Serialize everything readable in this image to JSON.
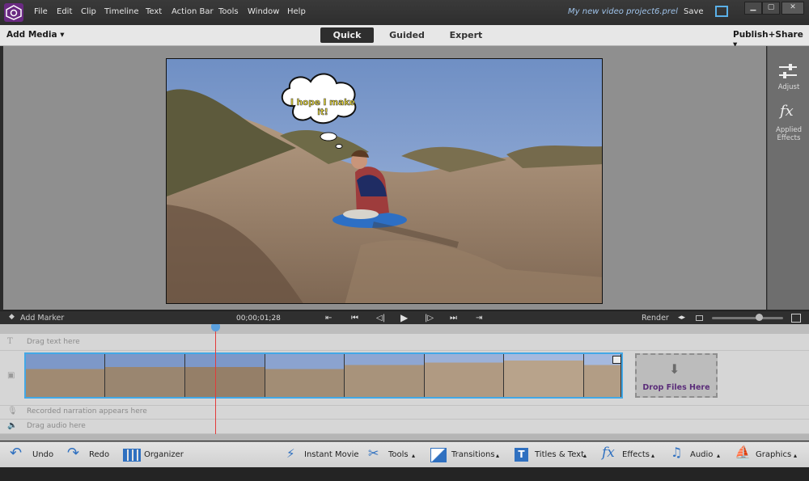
{
  "menubar": {
    "items": [
      "File",
      "Edit",
      "Clip",
      "Timeline",
      "Text",
      "Action Bar",
      "Tools",
      "Window",
      "Help"
    ],
    "project_name": "My new video project6.prel",
    "save_label": "Save"
  },
  "modebar": {
    "add_media_label": "Add Media",
    "tabs": [
      "Quick",
      "Guided",
      "Expert"
    ],
    "active_tab": "Quick",
    "publish_label": "Publish+Share"
  },
  "monitor": {
    "speech_bubble_text": "I hope I make it!"
  },
  "right_panel": {
    "adjust_label": "Adjust",
    "applied_effects_label": "Applied Effects"
  },
  "transport": {
    "add_marker_label": "Add Marker",
    "timecode": "00;00;01;28",
    "render_label": "Render"
  },
  "timeline": {
    "text_track_hint": "Drag text here",
    "narration_hint": "Recorded narration appears here",
    "audio_hint": "Drag audio here",
    "drop_files_label": "Drop Files Here"
  },
  "actionbar": {
    "undo_label": "Undo",
    "redo_label": "Redo",
    "organizer_label": "Organizer",
    "instant_movie_label": "Instant Movie",
    "tools_label": "Tools",
    "transitions_label": "Transitions",
    "titles_label": "Titles & Text",
    "effects_label": "Effects",
    "audio_label": "Audio",
    "graphics_label": "Graphics"
  },
  "colors": {
    "accent_blue": "#43a8e6",
    "playhead_red": "#e23b3b",
    "brand_purple": "#6a2a82"
  }
}
